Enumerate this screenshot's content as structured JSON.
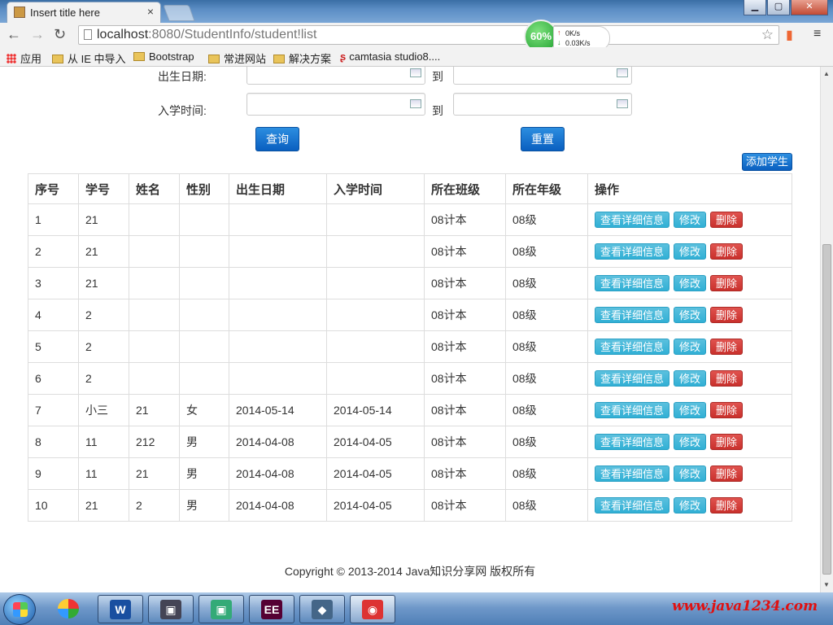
{
  "browser": {
    "tab_title": "Insert title here",
    "tab_close": "×",
    "url_host": "localhost",
    "url_rest": ":8080/StudentInfo/student!list",
    "window_buttons": {
      "minimize": "▁",
      "maximize": "▢",
      "close": "✕"
    },
    "speed_widget": {
      "percent": "60%",
      "upload": "0K/s",
      "download": "0.03K/s"
    }
  },
  "bookmarks": [
    {
      "label": "应用",
      "kind": "apps"
    },
    {
      "label": "从 IE 中导入",
      "kind": "folder"
    },
    {
      "label": "Bootstrap",
      "kind": "folder"
    },
    {
      "label": "常进网站",
      "kind": "folder"
    },
    {
      "label": "解决方案",
      "kind": "folder"
    },
    {
      "label": "camtasia studio8....",
      "kind": "link"
    }
  ],
  "search_form": {
    "birth_label": "出生日期:",
    "enroll_label": "入学时间:",
    "to_label": "到",
    "birth_from": "",
    "birth_to": "",
    "enroll_from": "",
    "enroll_to": "",
    "query_button": "查询",
    "reset_button": "重置"
  },
  "add_student_button": "添加学生",
  "table": {
    "headers": [
      "序号",
      "学号",
      "姓名",
      "性别",
      "出生日期",
      "入学时间",
      "所在班级",
      "所在年级",
      "操作"
    ],
    "rows": [
      [
        "1",
        "21",
        "",
        "",
        "",
        "",
        "08计本",
        "08级"
      ],
      [
        "2",
        "21",
        "",
        "",
        "",
        "",
        "08计本",
        "08级"
      ],
      [
        "3",
        "21",
        "",
        "",
        "",
        "",
        "08计本",
        "08级"
      ],
      [
        "4",
        "2",
        "",
        "",
        "",
        "",
        "08计本",
        "08级"
      ],
      [
        "5",
        "2",
        "",
        "",
        "",
        "",
        "08计本",
        "08级"
      ],
      [
        "6",
        "2",
        "",
        "",
        "",
        "",
        "08计本",
        "08级"
      ],
      [
        "7",
        "小三",
        "21",
        "女",
        "2014-05-14",
        "2014-05-14",
        "08计本",
        "08级"
      ],
      [
        "8",
        "11",
        "212",
        "男",
        "2014-04-08",
        "2014-04-05",
        "08计本",
        "08级"
      ],
      [
        "9",
        "11",
        "21",
        "男",
        "2014-04-08",
        "2014-04-05",
        "08计本",
        "08级"
      ],
      [
        "10",
        "21",
        "2",
        "男",
        "2014-04-08",
        "2014-04-05",
        "08计本",
        "08级"
      ]
    ],
    "actions": {
      "detail": "查看详细信息",
      "edit": "修改",
      "delete": "删除"
    }
  },
  "footer": {
    "copyright": "Copyright © 2013-2014 Java知识分享网 版权所有"
  },
  "taskbar": {
    "watermark": "www.java1234.com",
    "apps": [
      {
        "name": "word",
        "glyph": "W",
        "color": "#1a4fa0"
      },
      {
        "name": "app-2",
        "glyph": "▣",
        "color": "#445"
      },
      {
        "name": "app-3",
        "glyph": "▣",
        "color": "#3a7"
      },
      {
        "name": "javaee-ide",
        "glyph": "EE",
        "color": "#503"
      },
      {
        "name": "app-5",
        "glyph": "◆",
        "color": "#468"
      },
      {
        "name": "chrome",
        "glyph": "◉",
        "color": "#d33"
      }
    ]
  },
  "colors": {
    "primary": "#0a5fc0",
    "info": "#31b0d5",
    "danger": "#c9302c",
    "watermark": "#e01010"
  }
}
